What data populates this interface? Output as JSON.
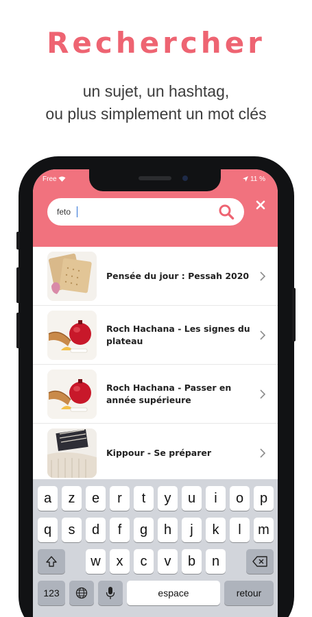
{
  "headline": "Rechercher",
  "subtitle_line1": "un sujet, un hashtag,",
  "subtitle_line2": "ou plus simplement un mot clés",
  "status": {
    "carrier": "Free",
    "battery": "11 %"
  },
  "search": {
    "value": "feto"
  },
  "results": [
    {
      "title": "Pensée du jour : Pessah 2020",
      "thumb": "matza"
    },
    {
      "title": "Roch Hachana - Les signes du plateau",
      "thumb": "shofar-pomegranate"
    },
    {
      "title": "Roch Hachana - Passer en année supérieure",
      "thumb": "shofar-pomegranate"
    },
    {
      "title": "Kippour - Se préparer",
      "thumb": "tallit"
    }
  ],
  "keyboard": {
    "row1": [
      "a",
      "z",
      "e",
      "r",
      "t",
      "y",
      "u",
      "i",
      "o",
      "p"
    ],
    "row2": [
      "q",
      "s",
      "d",
      "f",
      "g",
      "h",
      "j",
      "k",
      "l",
      "m"
    ],
    "row3": [
      "w",
      "x",
      "c",
      "v",
      "b",
      "n"
    ],
    "numbers_label": "123",
    "space_label": "espace",
    "return_label": "retour"
  },
  "colors": {
    "accent": "#ee6472",
    "header": "#f1727e"
  }
}
